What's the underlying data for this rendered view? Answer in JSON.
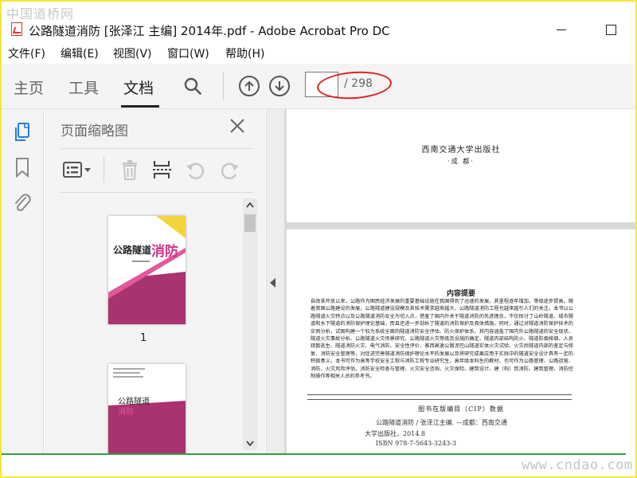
{
  "window": {
    "watermark_top": "中国道桥网",
    "title": "公路隧道消防 [张泽江 主编] 2014年.pdf - Adobe Acrobat Pro DC"
  },
  "menu": {
    "items": [
      "文件(F)",
      "编辑(E)",
      "视图(V)",
      "窗口(W)",
      "帮助(H)"
    ]
  },
  "toolbar": {
    "tabs": [
      "主页",
      "工具",
      "文档"
    ],
    "active_tab": "文档",
    "page_current": "",
    "page_total": "/ 298"
  },
  "panel": {
    "title": "页面缩略图",
    "thumbnails": [
      {
        "page_label": "1",
        "book_title_a": "公路隧道",
        "book_title_b": "消防"
      },
      {
        "book_title_a": "公路隧道",
        "book_title_b": "消防"
      }
    ]
  },
  "document": {
    "page1": {
      "publisher": "西南交通大学出版社",
      "city": "·成 都·"
    },
    "page2": {
      "heading": "内容提要",
      "body": "自改革开放以来，公路作为国民经济发展的重要基础设施在我国得到了迅速的发展，其里程逐年增加，等级逐步提高。随着我国公路建设的发展，公路隧道建设规模及其技术需求越来越大，公路隧道消防工程也越来越引人们的关注。本书以公路隧道火灾特点以及公路隧道消防安全为切入点，借鉴了国内外关于隧道消防的先进理念，不仅探讨了山岭隧道、城市隧道和水下隧道的消防保护理论基础，而且还进一步剖析了隧道的消防保护及具体措施。同时，通过对隧道消防保护技术的实例分析，试图构建一个较为系统全面的隧道消防安全评估、防火保护体系。其内容涵盖了国内外公路隧道的安全现状、隧道火灾事故分析、公路隧道火灾场景研究、公路隧道火灾等级及设施的确定、隧道内部结构防火、隧道防烟排烟、人员疏散逃生、隧道消防火灾、电气消防、安全性评价、雅西高速公路泥巴山隧道实体火灾试验、火灾后隧道内部的鉴定与修复、消防安全管理等，对促进完善隧道消防保护理论水平的发展以及将研究成果应用于实践中的隧道安全设计具有一定的积极意义。本书可作为高等学校安全工程与消防工程专业研究生、高年级本科生的教材，也可作为公路管理、公路运营、消防、火灾风险评估、消防安全检查与管理、火灾安全咨询、火灾保险、建筑设计、建（构）筑消防、建筑管理、消防控制操作等相关人员的参考书。",
      "cip_title": "图书在版编目（CIP）数据",
      "cip_line1": "公路隧道消防 / 张泽江主编. —成都：西南交通",
      "cip_line2": "大学出版社，2014.8",
      "cip_line3": "ISBN 978-7-5643-3243-3"
    }
  },
  "bottom": {
    "watermark": "www.cndao.com"
  },
  "colors": {
    "highlight_oval": "#e02020",
    "acrobat_blue": "#2b7dd6",
    "cover_magenta": "#a8336e",
    "cover_yellow": "#f2d53c",
    "bottom_line": "#3c9a43"
  }
}
